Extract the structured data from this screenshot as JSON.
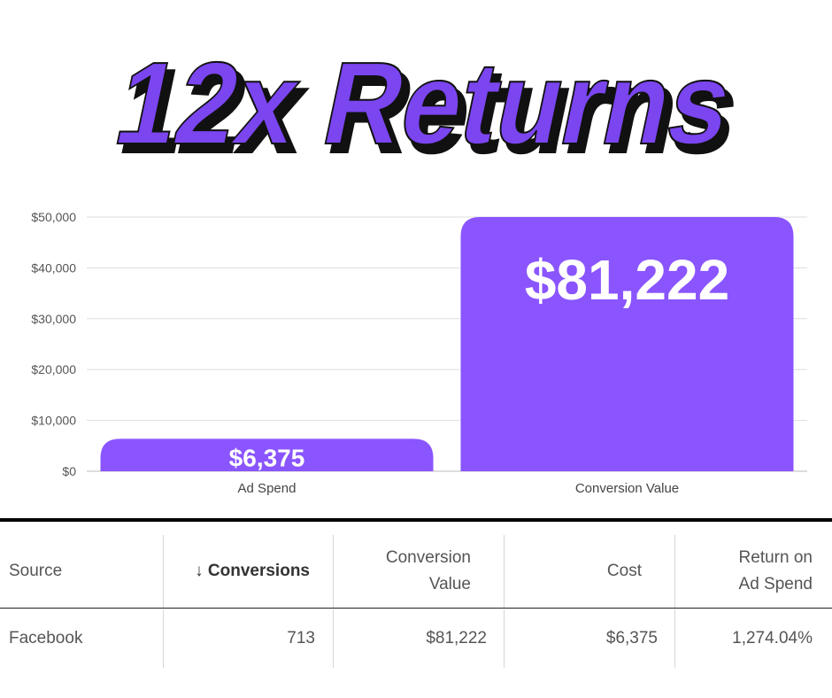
{
  "headline": "12x Returns",
  "colors": {
    "accent": "#7c4dff",
    "bar": "#8a55ff",
    "headline_fill": "#7b45f0",
    "headline_shadow": "#111111",
    "text": "#555555"
  },
  "chart_data": {
    "type": "bar",
    "categories": [
      "Ad Spend",
      "Conversion Value"
    ],
    "values": [
      6375,
      81222
    ],
    "data_labels": [
      "$6,375",
      "$81,222"
    ],
    "ylim": [
      0,
      50000
    ],
    "yticks": [
      0,
      10000,
      20000,
      30000,
      40000,
      50000
    ],
    "ytick_labels": [
      "$0",
      "$10,000",
      "$20,000",
      "$30,000",
      "$40,000",
      "$50,000"
    ],
    "grid": true
  },
  "table": {
    "headers": [
      {
        "label": "Source",
        "lines": [
          "Source"
        ]
      },
      {
        "label": "↓ Conversions",
        "lines": [
          "↓ Conversions"
        ]
      },
      {
        "label": "Conversion Value",
        "lines": [
          "Conversion",
          "Value"
        ]
      },
      {
        "label": "Cost",
        "lines": [
          "Cost"
        ]
      },
      {
        "label": "Return on Ad Spend",
        "lines": [
          "Return on",
          "Ad Spend"
        ]
      }
    ],
    "rows": [
      [
        "Facebook",
        "713",
        "$81,222",
        "$6,375",
        "1,274.04%"
      ]
    ]
  }
}
